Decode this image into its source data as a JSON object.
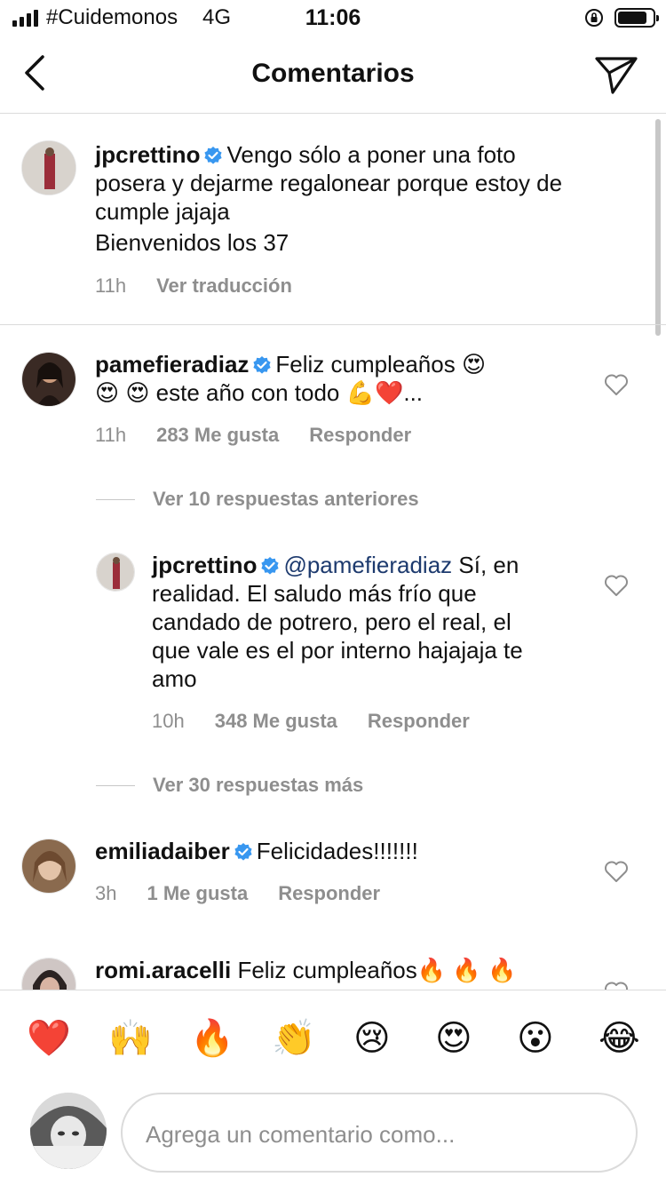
{
  "status_bar": {
    "carrier": "#Cuidemonos",
    "network": "4G",
    "time": "11:06"
  },
  "header": {
    "title": "Comentarios"
  },
  "caption": {
    "username": "jpcrettino",
    "text_lines": [
      "Vengo sólo a poner una foto",
      "posera y dejarme regalonear porque estoy de",
      "cumple jajaja",
      "Bienvenidos los 37"
    ],
    "time": "11h",
    "translate_label": "Ver traducción"
  },
  "comments": [
    {
      "username": "pamefieradiaz",
      "line1": "Feliz cumpleaños 😍",
      "line2": "😍 😍  este año con todo 💪❤️...",
      "time": "11h",
      "likes": "283 Me gusta",
      "reply_label": "Responder",
      "view_replies": "Ver 10 respuestas anteriores"
    },
    {
      "username": "jpcrettino",
      "mention": "@pamefieradiaz",
      "first_line_rest": "Sí, en",
      "lines": [
        "realidad. El saludo más frío que",
        "candado de potrero, pero el real, el",
        "que vale es el por interno hajajaja te",
        "amo"
      ],
      "time": "10h",
      "likes": "348 Me gusta",
      "reply_label": "Responder",
      "view_replies": "Ver 30 respuestas más"
    },
    {
      "username": "emiliadaiber",
      "text": "Felicidades!!!!!!!",
      "time": "3h",
      "likes": "1 Me gusta",
      "reply_label": "Responder"
    },
    {
      "username": "romi.aracelli",
      "text": "Feliz cumpleaños🔥 🔥 🔥"
    }
  ],
  "emoji_bar": [
    "❤️",
    "🙌",
    "🔥",
    "👏",
    "😢",
    "😍",
    "😮",
    "😂"
  ],
  "composer": {
    "placeholder": "Agrega un comentario como..."
  },
  "colors": {
    "verified": "#3897f0",
    "secondary_text": "#8e8e8e",
    "mention": "#1d3a6e"
  }
}
